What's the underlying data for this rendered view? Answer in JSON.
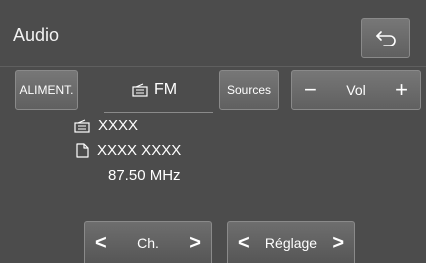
{
  "header": {
    "title": "Audio",
    "back_icon": "return-arrow-icon"
  },
  "controls": {
    "aliment_label": "ALIMENT.",
    "band_label": "FM",
    "band_icon": "radio-icon",
    "sources_label": "Sources",
    "volume": {
      "minus": "−",
      "label": "Vol",
      "plus": "+"
    }
  },
  "info": {
    "station_icon": "radio-station-icon",
    "station": "XXXX",
    "text_icon": "document-icon",
    "radio_text": "XXXX XXXX",
    "frequency": "87.50 MHz"
  },
  "bottom": {
    "channel_label": "Ch.",
    "tune_label": "Réglage",
    "prev_symbol": "<",
    "next_symbol": ">"
  },
  "colors": {
    "screen_bg": "#4c4c4c",
    "button_bg": "#6a6a6a",
    "text": "#ffffff"
  }
}
